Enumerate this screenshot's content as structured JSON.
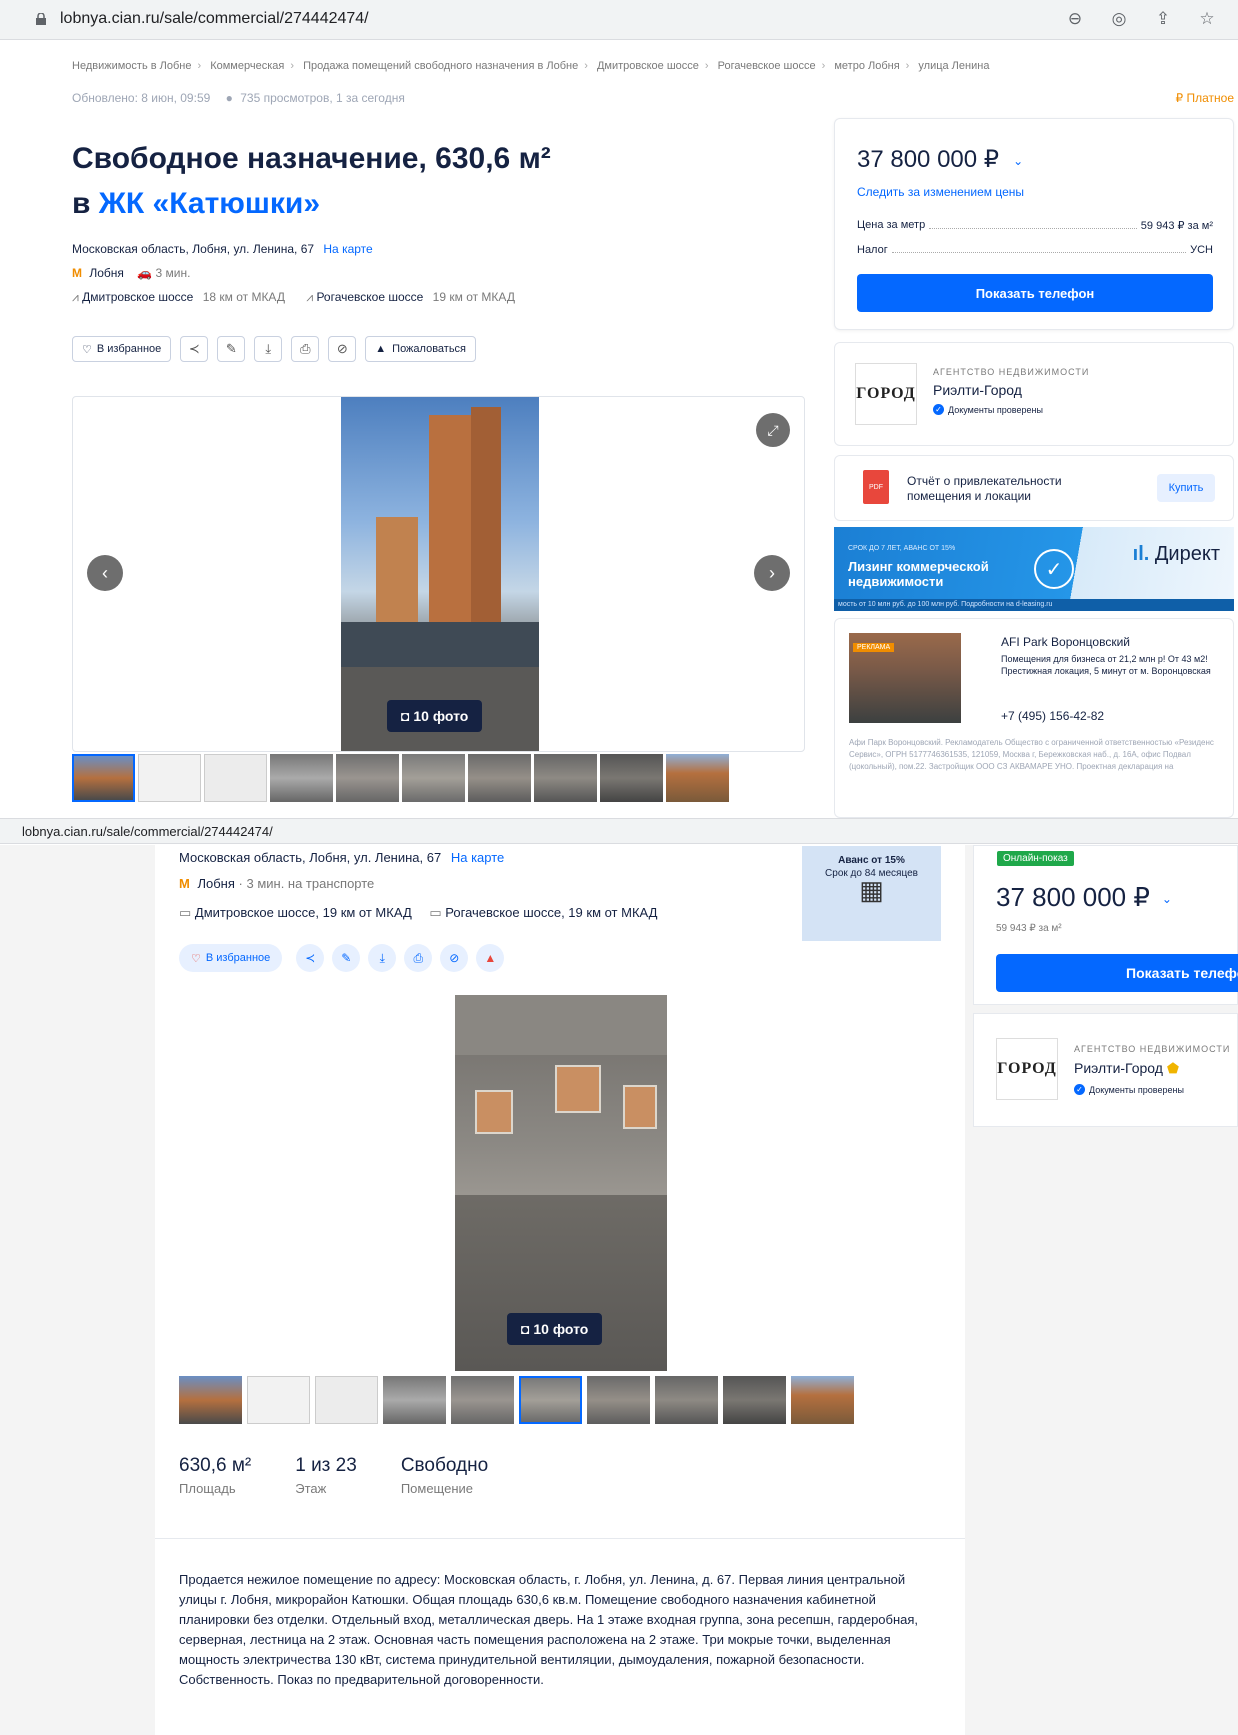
{
  "browser": {
    "url": "lobnya.cian.ru/sale/commercial/274442474/",
    "url2": "lobnya.cian.ru/sale/commercial/274442474/"
  },
  "breadcrumbs": [
    "Недвижимость в Лобне",
    "Коммерческая",
    "Продажа помещений свободного назначения в Лобне",
    "Дмитровское шоссе",
    "Рогачевское шоссе",
    "метро Лобня",
    "улица Ленина"
  ],
  "meta": {
    "updated": "Обновлено: 8 июн, 09:59",
    "views": "735 просмотров, 1 за сегодня",
    "paid": "Платное"
  },
  "title": {
    "line1": "Свободное назначение, 630,6 м²",
    "prefix": "в ",
    "complex": "ЖК «Катюшки»"
  },
  "address": {
    "text": "Московская область, Лобня, ул. Ленина, 67",
    "map_link": "На карте",
    "metro": "Лобня",
    "metro_time": "3 мин.",
    "road1": "Дмитровское шоссе",
    "road1_dist": "18 км от МКАД",
    "road2": "Рогачевское шоссе",
    "road2_dist": "19 км от МКАД"
  },
  "actions": {
    "favorite": "В избранное",
    "complain": "Пожаловаться"
  },
  "gallery": {
    "photo_count": "10 фото"
  },
  "price_card": {
    "price": "37 800 000 ₽",
    "follow": "Следить за изменением цены",
    "ppm_label": "Цена за метр",
    "ppm_value": "59 943 ₽ за м²",
    "tax_label": "Налог",
    "tax_value": "УСН",
    "show_phone": "Показать телефон"
  },
  "agent": {
    "type": "АГЕНТСТВО НЕДВИЖИМОСТИ",
    "name": "Риэлти-Город",
    "verified": "Документы проверены",
    "logo": "ГОРОД"
  },
  "report": {
    "pdf": "PDF",
    "text_line1": "Отчёт о привлекательности",
    "text_line2": "помещения и локации",
    "buy": "Купить"
  },
  "banner": {
    "small": "СРОК ДО 7 ЛЕТ, АВАНС ОТ 15%",
    "line1": "Лизинг коммерческой",
    "line2": "недвижимости",
    "foot": "мость от 10 млн руб. до 100 млн руб. Подробности на d-leasing.ru",
    "brand": "Директ"
  },
  "ad": {
    "badge": "РЕКЛАМА",
    "title": "AFI Park Воронцовский",
    "desc": "Помещения для бизнеса от 21,2 млн р! От 43 м2! Престижная локация, 5 минут от м. Воронцовская",
    "phone": "+7 (495) 156-42-82",
    "legal": "Афи Парк Воронцовский. Рекламодатель Общество с ограниченной ответственностью «Резиденс Сервис», ОГРН 5177746361535, 121059, Москва г, Бережковская наб., д. 16А, офис Подвал (цокольный), пом.22. Застройщик ООО СЗ АКВАМАРЕ УНО. Проектная декларация на"
  },
  "lower": {
    "address": "Московская область, Лобня, ул. Ленина, 67",
    "map_link": "На карте",
    "metro": "Лобня",
    "metro_time": "· 3 мин. на транспорте",
    "road1": "Дмитровское шоссе, 19 км от МКАД",
    "road2": "Рогачевское шоссе, 19 км от МКАД",
    "avans1": "Аванс от 15%",
    "avans2": "Срок до 84 месяцев",
    "favorite": "В избранное",
    "photo_count": "10 фото",
    "stats": [
      {
        "value": "630,6 м²",
        "label": "Площадь"
      },
      {
        "value": "1 из 23",
        "label": "Этаж"
      },
      {
        "value": "Свободно",
        "label": "Помещение"
      }
    ],
    "description": "Продается нежилое помещение по адресу: Московская область, г. Лобня, ул. Ленина, д. 67. Первая линия центральной улицы г. Лобня, микрорайон Катюшки. Общая площадь 630,6 кв.м. Помещение свободного назначения кабинетной планировки без отделки. Отдельный вход, металлическая дверь. На 1 этаже входная группа, зона ресепшн, гардеробная, серверная, лестница на 2 этаж. Основная часть помещения расположена на 2 этаже. Три мокрые точки, выделенная мощность электричества 130 кВт, система принудительной вентиляции, дымоудаления, пожарной безопасности. Собственность. Показ по предварительной договоренности."
  },
  "right_lower": {
    "online": "Онлайн-показ",
    "price": "37 800 000 ₽",
    "ppm": "59 943 ₽ за м²",
    "show_phone": "Показать телефон"
  },
  "colors": {
    "accent": "#0468ff",
    "text": "#152242",
    "metro": "#f08d00"
  }
}
